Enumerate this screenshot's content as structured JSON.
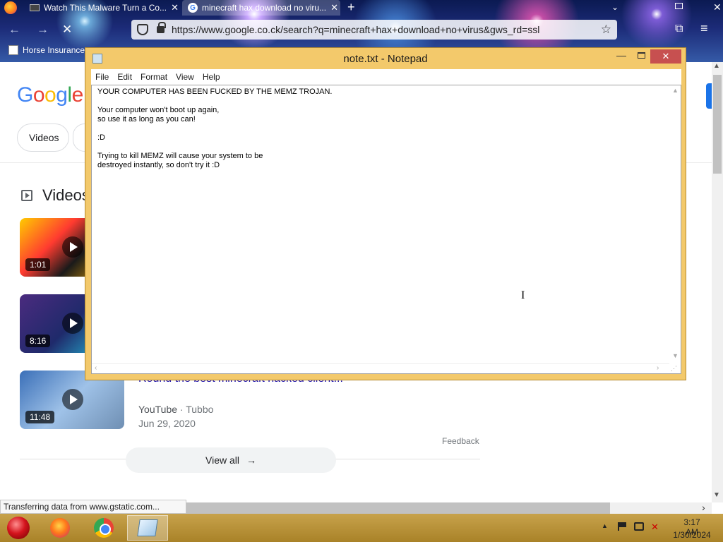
{
  "browser": {
    "tabs": [
      {
        "title": "Watch This Malware Turn a Co..."
      },
      {
        "title": "minecraft hax download no viru..."
      }
    ],
    "new_tab_symbol": "+",
    "url": "https://www.google.co.ck/search?q=minecraft+hax+download+no+virus&gws_rd=ssl",
    "bookmark": "Horse Insurance"
  },
  "google": {
    "logo_letters": [
      "G",
      "o",
      "o",
      "g",
      "l",
      "e"
    ],
    "chips": [
      "Videos"
    ],
    "right_fragment": "s",
    "videos_heading": "Videos",
    "videos": [
      {
        "duration": "1:01"
      },
      {
        "duration": "8:16"
      },
      {
        "duration": "11:48",
        "title": "Round the best minecraft hacked client...",
        "source": "YouTube",
        "channel": "Tubbo",
        "date": "Jun 29, 2020"
      }
    ],
    "source_separator": " · ",
    "feedback": "Feedback",
    "view_all": "View all"
  },
  "notepad": {
    "title": "note.txt - Notepad",
    "menu": [
      "File",
      "Edit",
      "Format",
      "View",
      "Help"
    ],
    "content": "YOUR COMPUTER HAS BEEN FUCKED BY THE MEMZ TROJAN.\n\nYour computer won't boot up again,\nso use it as long as you can!\n\n:D\n\nTrying to kill MEMZ will cause your system to be\ndestroyed instantly, so don't try it :D"
  },
  "status_bar": "Transferring data from www.gstatic.com...",
  "taskbar": {
    "time": "3:17 AM",
    "date": "1/30/2024"
  },
  "icons": {
    "firefox": "firefox-logo",
    "shield": "shield-icon",
    "lock": "lock-icon",
    "star": "star-icon",
    "extensions": "extensions-icon",
    "menu": "hamburger-menu-icon"
  }
}
